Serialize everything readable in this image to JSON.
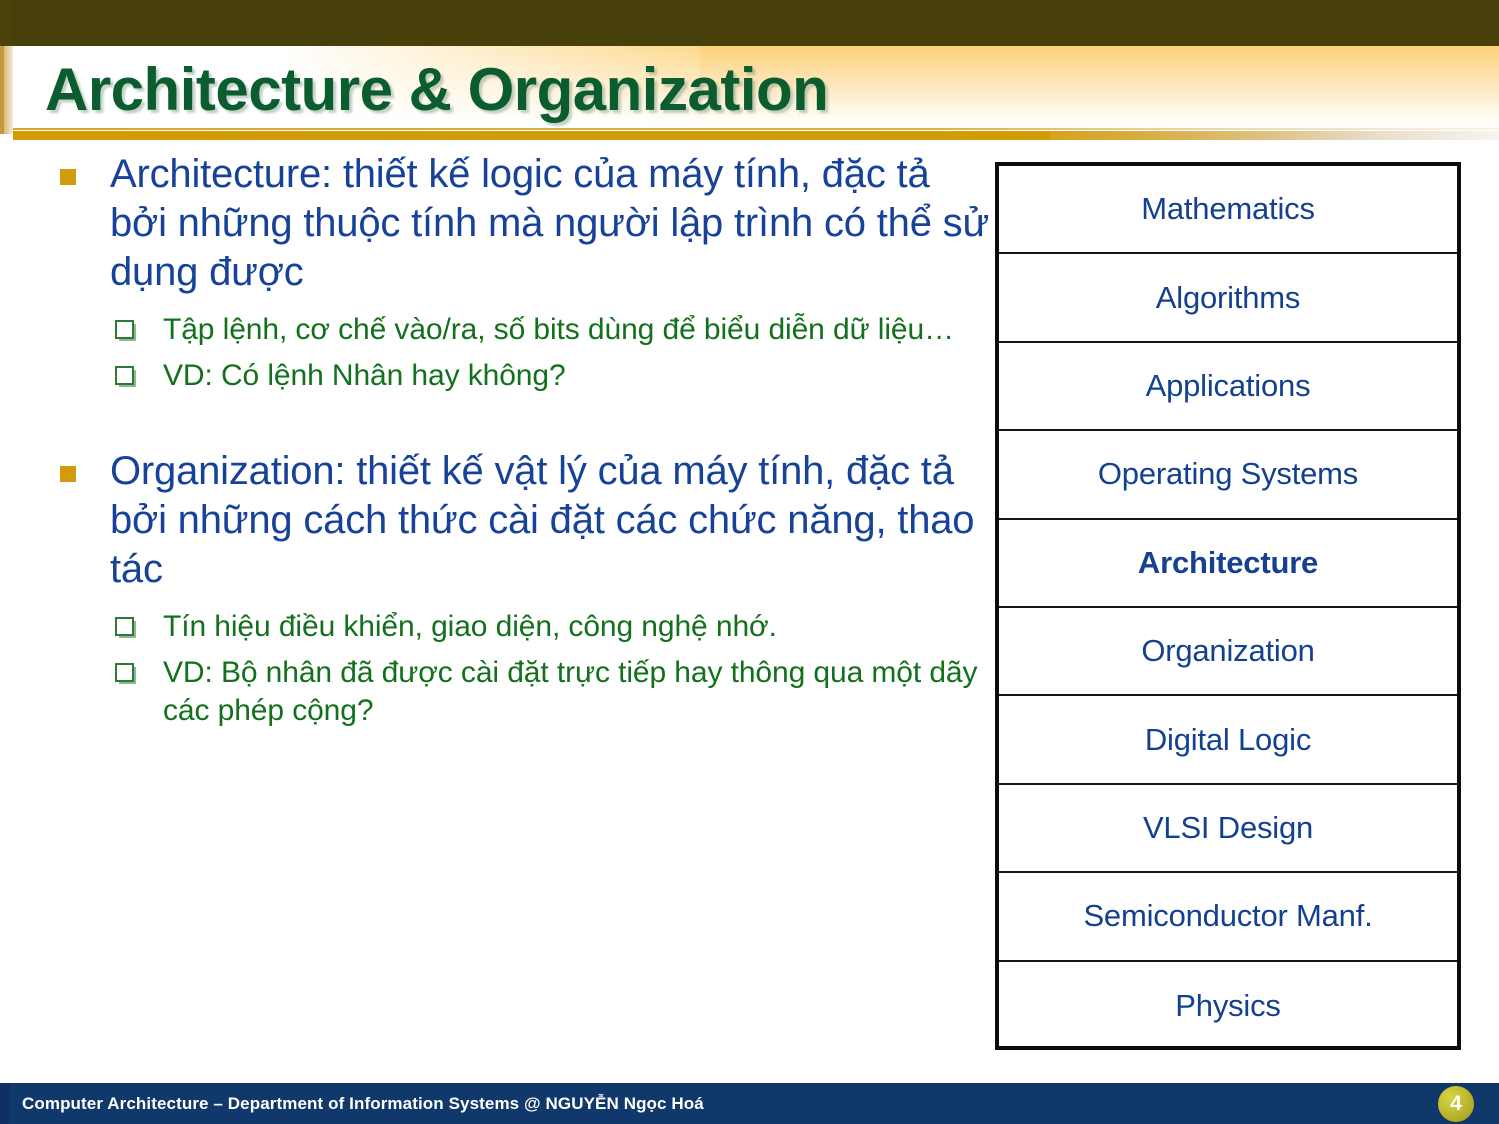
{
  "slide": {
    "title": "Architecture & Organization",
    "number": "4"
  },
  "colors": {
    "title_green": "#0b5c2e",
    "level1_blue": "#17429a",
    "level2_green": "#13701d",
    "bullet_gold": "#d19b0b",
    "banner_olive": "#47400a",
    "rule_gold": "#d29c09",
    "footer_navy": "#11386b",
    "table_blue": "#14418f",
    "badge_gold": "#c3bd32"
  },
  "content": {
    "blocks": [
      {
        "level1": "Architecture: thiết kế logic của máy tính, đặc tả bởi những thuộc tính mà người lập trình có thể sử dụng được",
        "sub": [
          "Tập lệnh, cơ chế vào/ra, số bits dùng để biểu diễn dữ liệu…",
          "VD: Có lệnh Nhân hay không?"
        ]
      },
      {
        "level1": "Organization: thiết kế vật lý của máy tính, đặc tả bởi những cách thức cài đặt các chức năng, thao tác",
        "sub": [
          "Tín hiệu điều khiển, giao diện, công nghệ nhớ.",
          "VD: Bộ nhân đã được cài đặt trực tiếp hay thông qua một dãy các phép cộng?"
        ]
      }
    ]
  },
  "stack_table": {
    "rows": [
      {
        "label": "Mathematics",
        "highlight": false
      },
      {
        "label": "Algorithms",
        "highlight": false
      },
      {
        "label": "Applications",
        "highlight": false
      },
      {
        "label": "Operating Systems",
        "highlight": false
      },
      {
        "label": "Architecture",
        "highlight": true
      },
      {
        "label": "Organization",
        "highlight": false
      },
      {
        "label": "Digital Logic",
        "highlight": false
      },
      {
        "label": "VLSI Design",
        "highlight": false
      },
      {
        "label": "Semiconductor Manf.",
        "highlight": false
      },
      {
        "label": "Physics",
        "highlight": false
      }
    ]
  },
  "footer": {
    "text": "Computer Architecture – Department of Information Systems @ NGUYỄN Ngọc Hoá"
  }
}
